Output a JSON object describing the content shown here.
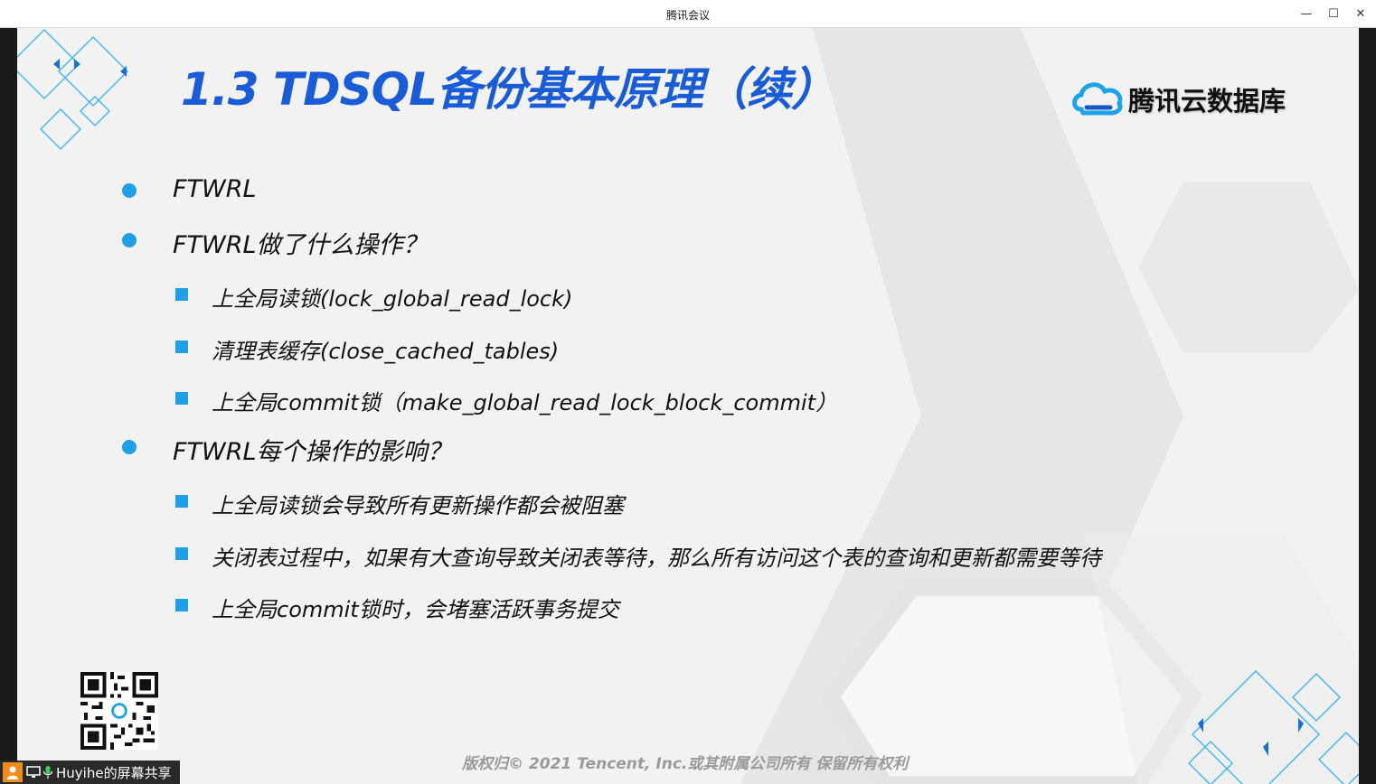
{
  "window": {
    "title": "腾讯会议",
    "minimize_glyph": "—",
    "maximize_glyph": "☐",
    "close_glyph": "✕"
  },
  "slide": {
    "title": "1.3 TDSQL备份基本原理（续）",
    "brand": "腾讯云数据库",
    "bullets": [
      {
        "level": 1,
        "text": "FTWRL"
      },
      {
        "level": 1,
        "text": "FTWRL做了什么操作？"
      },
      {
        "level": 2,
        "text": "上全局读锁(lock_global_read_lock)"
      },
      {
        "level": 2,
        "text": "清理表缓存(close_cached_tables)"
      },
      {
        "level": 2,
        "text": "上全局commit锁（make_global_read_lock_block_commit）"
      },
      {
        "level": 1,
        "text": "FTWRL每个操作的影响？"
      },
      {
        "level": 2,
        "text": "上全局读锁会导致所有更新操作都会被阻塞"
      },
      {
        "level": 2,
        "text": "关闭表过程中，如果有大查询导致关闭表等待，那么所有访问这个表的查询和更新都需要等待"
      },
      {
        "level": 2,
        "text": "上全局commit锁时，会堵塞活跃事务提交"
      }
    ],
    "footer": "版权归© 2021 Tencent, Inc.或其附属公司所有 保留所有权利",
    "accent_color": "#1a5bd6",
    "bullet_color": "#1e9fe6"
  },
  "share_badge": {
    "label": "Huyihe的屏幕共享"
  }
}
